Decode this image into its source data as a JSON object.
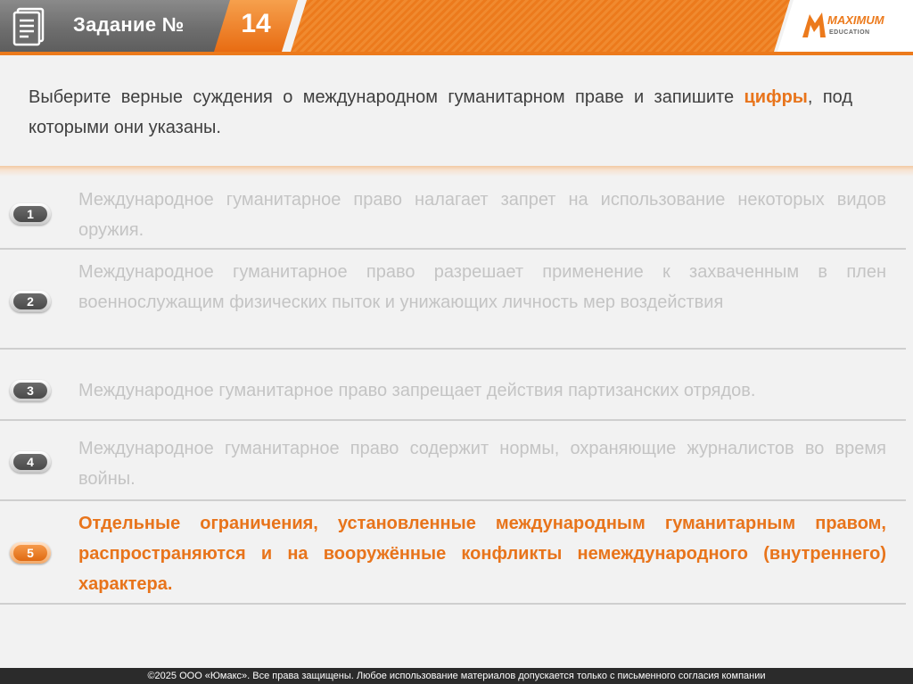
{
  "header": {
    "title": "Задание №",
    "task_number": "14",
    "logo": {
      "brand": "MAXIMUM",
      "sub": "EDUCATION",
      "accent": "#ec7a1c"
    }
  },
  "question": {
    "part1": "Выберите верные суждения о международном гуманитарном праве и запишите ",
    "emphasis": "цифры",
    "part2": ", под которыми они указаны."
  },
  "options": [
    {
      "number": "1",
      "text": "Международное гуманитарное право налагает запрет на использование некоторых видов оружия.",
      "correct": false
    },
    {
      "number": "2",
      "text": "Международное гуманитарное право разрешает применение к захваченным в плен военнослужащим физических пыток и унижающих личность мер воздействия",
      "correct": false
    },
    {
      "number": "3",
      "text": "Международное гуманитарное право запрещает действия партизанских отрядов.",
      "correct": false
    },
    {
      "number": "4",
      "text": "Международное гуманитарное право содержит нормы, охраняющие журналистов во время войны.",
      "correct": false
    },
    {
      "number": "5",
      "text": "Отдельные ограничения, установленные международным гуманитарным правом, распространяются и на вооружённые конфликты немеждународного (внутреннего) характера.",
      "correct": true
    }
  ],
  "colors": {
    "accent": "#e8741b",
    "muted_text": "#c4c4c4",
    "header_gray": "#6e6e6e"
  },
  "footer": {
    "text": "©2025 ООО «Юмакс». Все права защищены. Любое использование материалов допускается только с  письменного согласия компании"
  }
}
